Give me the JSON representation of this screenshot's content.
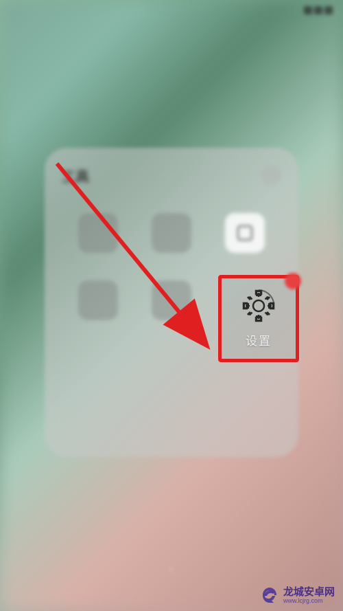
{
  "status": {
    "time": "",
    "carrier": ""
  },
  "folder": {
    "title": "工具",
    "apps": [
      {
        "label": ""
      },
      {
        "label": ""
      },
      {
        "label": ""
      },
      {
        "label": ""
      },
      {
        "label": ""
      }
    ]
  },
  "highlighted_app": {
    "label": "设置",
    "icon_name": "gear"
  },
  "annotation": {
    "highlight_color": "#e02020",
    "arrow_color": "#e02020"
  },
  "watermark": {
    "name": "龙城安卓网",
    "url": "www.lcjrg.com"
  }
}
